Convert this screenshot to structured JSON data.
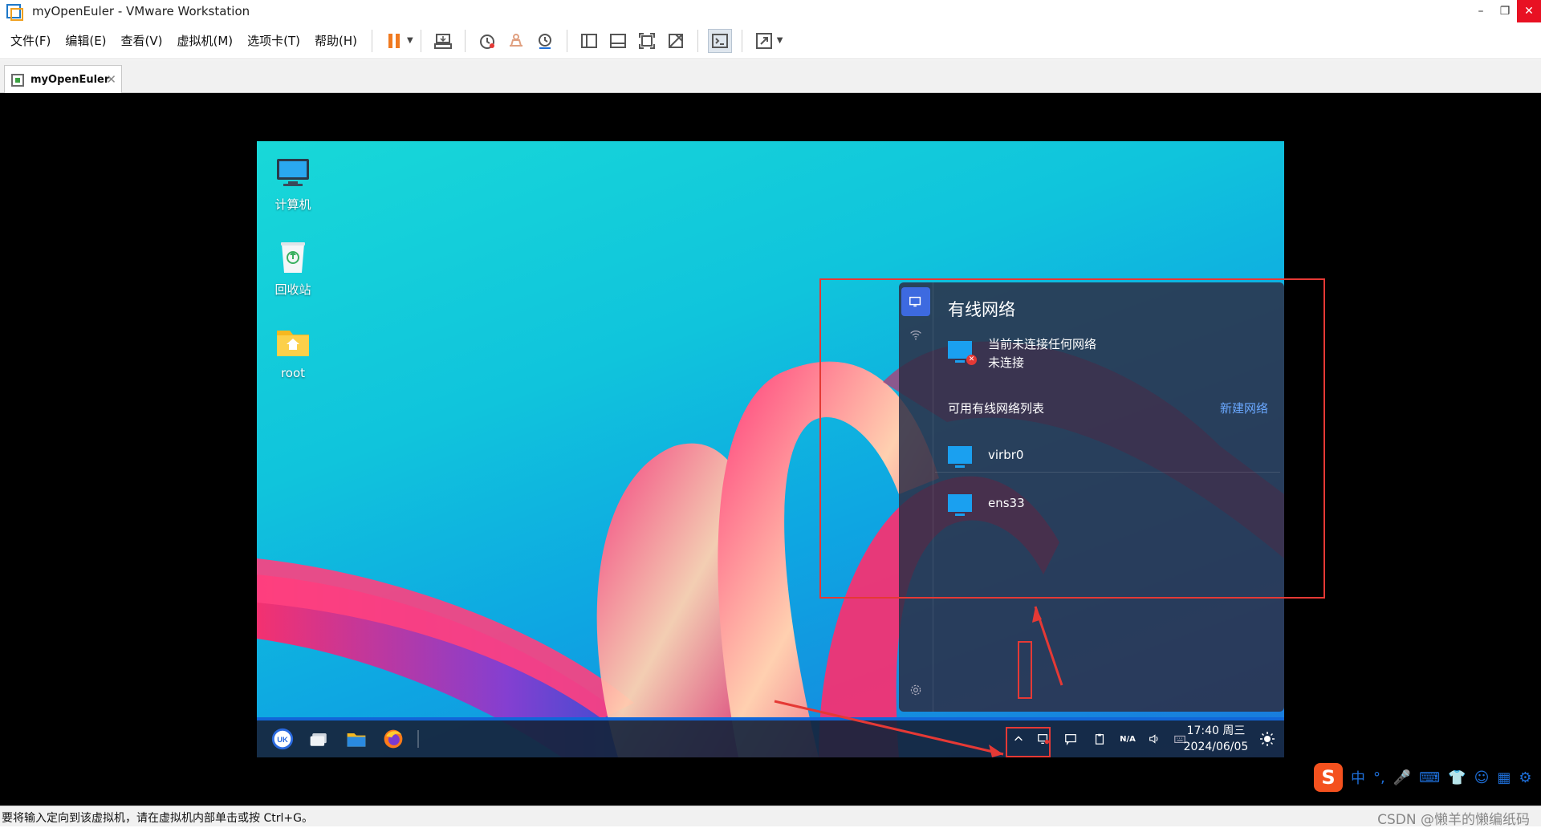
{
  "window": {
    "title": "myOpenEuler - VMware Workstation",
    "controls": [
      "–",
      "❐",
      "✕"
    ]
  },
  "menu": [
    "文件(F)",
    "编辑(E)",
    "查看(V)",
    "虚拟机(M)",
    "选项卡(T)",
    "帮助(H)"
  ],
  "tab": {
    "label": "myOpenEuler",
    "close": "✕"
  },
  "desktop": {
    "icons": [
      {
        "label": "计算机",
        "icon": "computer-icon"
      },
      {
        "label": "回收站",
        "icon": "trash-icon"
      },
      {
        "label": "root",
        "icon": "home-folder-icon"
      }
    ]
  },
  "network_panel": {
    "title": "有线网络",
    "current_status": "当前未连接任何网络",
    "current_state": "未连接",
    "list_header": "可用有线网络列表",
    "new_network": "新建网络",
    "networks": [
      "virbr0",
      "ens33"
    ]
  },
  "taskbar": {
    "apps": [
      "start-menu-icon",
      "multitask-icon",
      "file-manager-icon",
      "firefox-icon"
    ],
    "tray": [
      "chevron-up-icon",
      "network-icon",
      "notification-icon",
      "clipboard-icon",
      "battery-icon",
      "volume-icon",
      "keyboard-icon"
    ],
    "battery_label": "N/A",
    "time": "17:40 周三",
    "date": "2024/06/05"
  },
  "ime": {
    "logo": "S",
    "mode": "中",
    "punct": "°,"
  },
  "status": {
    "text": "要将输入定向到该虚拟机，请在虚拟机内部单击或按 Ctrl+G。",
    "watermark": "CSDN @懒羊的懒编纸码"
  },
  "colors": {
    "accent": "#1166d8",
    "annotation": "#e53935",
    "close": "#e81123"
  }
}
